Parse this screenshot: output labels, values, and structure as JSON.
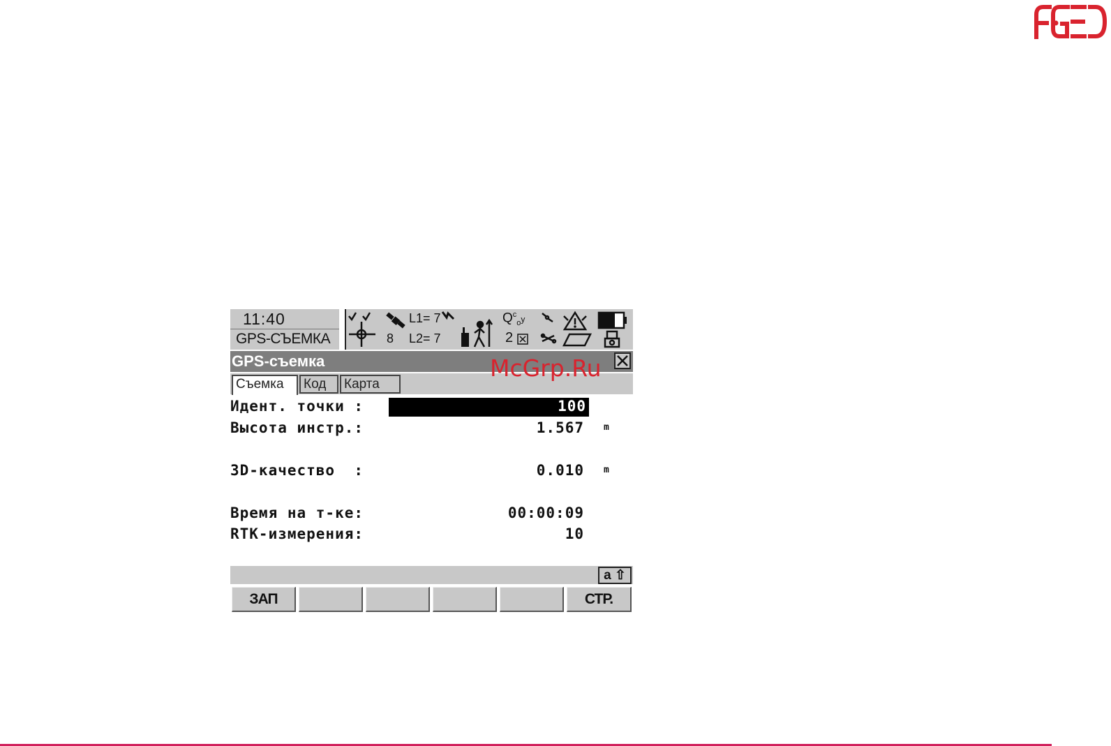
{
  "logo": {
    "text": "AGED"
  },
  "watermark": "McGrp.Ru",
  "status": {
    "time": "11:40",
    "app": "GPS-СЪЕМКА",
    "sat_count": "8",
    "l1": "L1= 7",
    "l2": "L2= 7",
    "quality": "2",
    "icons": [
      "crosshair-icon",
      "satellite-icon",
      "antenna-icon",
      "walking-man-icon",
      "quality-icon",
      "link-icon",
      "warning-icon",
      "battery-icon",
      "card-icon",
      "memory-icon"
    ]
  },
  "window": {
    "title": "GPS-съемка"
  },
  "tabs": [
    {
      "label": "Съемка",
      "active": true
    },
    {
      "label": "Код",
      "active": false
    },
    {
      "label": "Карта",
      "active": false
    }
  ],
  "fields": {
    "point_id": {
      "label": "Идент. точки :",
      "value": "100"
    },
    "instr_height": {
      "label": "Высота инстр.:",
      "value": "1.567",
      "unit": "m"
    },
    "quality_3d": {
      "label": "3D-качество  :",
      "value": "0.010",
      "unit": "m"
    },
    "time_on_point": {
      "label": "Время на т-ке:",
      "value": "00:00:09"
    },
    "rtk_measurements": {
      "label": "RTK-измерения:",
      "value": "10"
    }
  },
  "input_mode": "a ⇧",
  "fkeys": [
    "ЗАП",
    "",
    "",
    "",
    "",
    "СТР."
  ],
  "colors": {
    "accent": "#d9232e",
    "screen_gray": "#c8c8c8",
    "title_gray": "#7e7e7e"
  }
}
